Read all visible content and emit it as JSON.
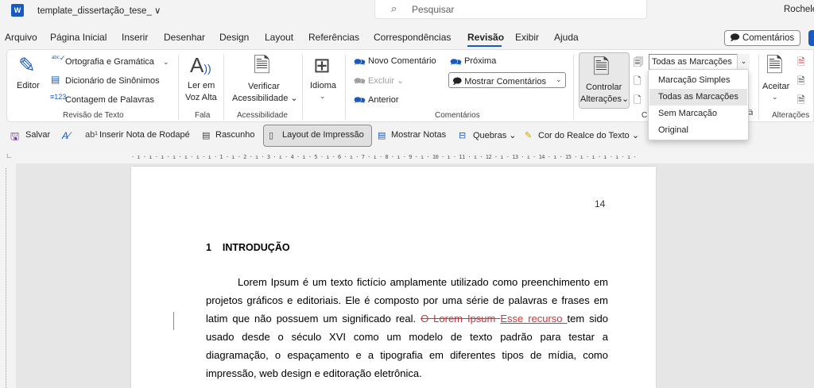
{
  "titlebar": {
    "app_icon": "W",
    "doc_title": "template_dissertação_tese_ ∨",
    "search_placeholder": "Pesquisar",
    "user": "Rochele"
  },
  "menu": {
    "items": [
      "Arquivo",
      "Página Inicial",
      "Inserir",
      "Desenhar",
      "Design",
      "Layout",
      "Referências",
      "Correspondências",
      "Revisão",
      "Exibir",
      "Ajuda"
    ],
    "active": "Revisão",
    "comments_button": "Comentários"
  },
  "ribbon": {
    "editor": "Editor",
    "spelling": "Ortografia e Gramática",
    "thesaurus": "Dicionário de Sinônimos",
    "word_count": "Contagem de Palavras",
    "group_proofing": "Revisão de Texto",
    "read_aloud_1": "Ler em",
    "read_aloud_2": "Voz Alta",
    "group_speech": "Fala",
    "check_access_1": "Verificar",
    "check_access_2": "Acessibilidade",
    "group_access": "Acessibilidade",
    "language": "Idioma",
    "new_comment": "Novo Comentário",
    "delete": "Excluir",
    "previous": "Anterior",
    "next": "Próxima",
    "show_comments": "Mostrar Comentários",
    "group_comments": "Comentários",
    "track_1": "Controlar",
    "track_2": "Alterações",
    "group_tracking_short": "C",
    "markup_value": "Todas as Marcações",
    "accept": "Aceitar",
    "group_changes": "Alterações"
  },
  "markup_dropdown": {
    "options": [
      "Marcação Simples",
      "Todas as Marcações",
      "Sem Marcação",
      "Original"
    ],
    "selected": "Todas as Marcações"
  },
  "quick_toolbar": {
    "save": "Salvar",
    "insert_footnote": "Inserir Nota de Rodapé",
    "draft": "Rascunho",
    "print_layout": "Layout de Impressão",
    "show_notes": "Mostrar Notas",
    "breaks": "Quebras",
    "highlight": "Cor do Realce do Texto"
  },
  "ruler": {
    "marks": "· ı · ı · ı · ı · ı · ı · ı · 1 · ı · 2 · ı · 3 · ı · 4 · ı · 5 · ı · 6 · ı · 7 · ı · 8 · ı · 9 · ı · 10 · ı · 11 · ı · 12 · ı · 13 · ı · 14 · ı · 15 · ı · ı · ı · ı · ı ·"
  },
  "document": {
    "page_number": "14",
    "heading_num": "1",
    "heading": "INTRODUÇÃO",
    "line1": "Lorem Ipsum é um texto fictício amplamente utilizado como preenchimento em",
    "line2": "projetos gráficos e editoriais. Ele é composto por uma série de palavras e frases em",
    "line3_a": "latim que não possuem um significado real.",
    "line3_del": "O Lorem Ipsum ",
    "line3_ins": "Esse recurso ",
    "line3_b": "tem sido",
    "line4": "usado desde o século XVI como um modelo de texto padrão para testar a",
    "line5": "diagramação, o espaçamento e a tipografia em diferentes tipos de mídia, como",
    "line6": "impressão, web design e editoração eletrônica."
  },
  "colors": {
    "accent": "#185abd",
    "revision": "#d13438"
  }
}
